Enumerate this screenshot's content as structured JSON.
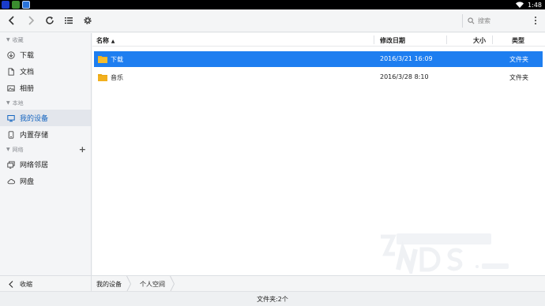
{
  "status_bar": {
    "time": "1:48",
    "app_icons": [
      "app-icon-blue",
      "android-icon",
      "app-icon-window"
    ]
  },
  "toolbar": {
    "icons": [
      "back-icon",
      "forward-icon",
      "refresh-icon",
      "list-view-icon",
      "settings-icon",
      "more-vertical-icon"
    ],
    "search_placeholder": "搜索"
  },
  "sidebar": {
    "sections": [
      {
        "title": "收藏",
        "items": [
          {
            "label": "下载",
            "icon": "download-icon"
          },
          {
            "label": "文档",
            "icon": "document-icon"
          },
          {
            "label": "相册",
            "icon": "photo-icon"
          }
        ]
      },
      {
        "title": "本地",
        "items": [
          {
            "label": "我的设备",
            "icon": "device-icon",
            "active": true
          },
          {
            "label": "内置存储",
            "icon": "storage-icon"
          }
        ]
      },
      {
        "title": "网络",
        "items": [
          {
            "label": "网络邻居",
            "icon": "network-icon"
          },
          {
            "label": "网盘",
            "icon": "cloud-icon"
          }
        ]
      }
    ],
    "collapse_label": "收缩"
  },
  "file_list": {
    "columns": {
      "name": "名称",
      "sort_indicator": "▲",
      "date": "修改日期",
      "size": "大小",
      "type": "类型"
    },
    "rows": [
      {
        "name": "下载",
        "date": "2016/3/21 16:09",
        "size": "",
        "type": "文件夹",
        "selected": true
      },
      {
        "name": "音乐",
        "date": "2016/3/28 8:10",
        "size": "",
        "type": "文件夹",
        "selected": false
      }
    ]
  },
  "breadcrumb": [
    "我的设备",
    "个人空间"
  ],
  "footer": {
    "status": "文件夹:2个"
  },
  "colors": {
    "selection": "#1e7ef0",
    "folder": "#f2b01e",
    "active_nav_text": "#1565c0"
  }
}
